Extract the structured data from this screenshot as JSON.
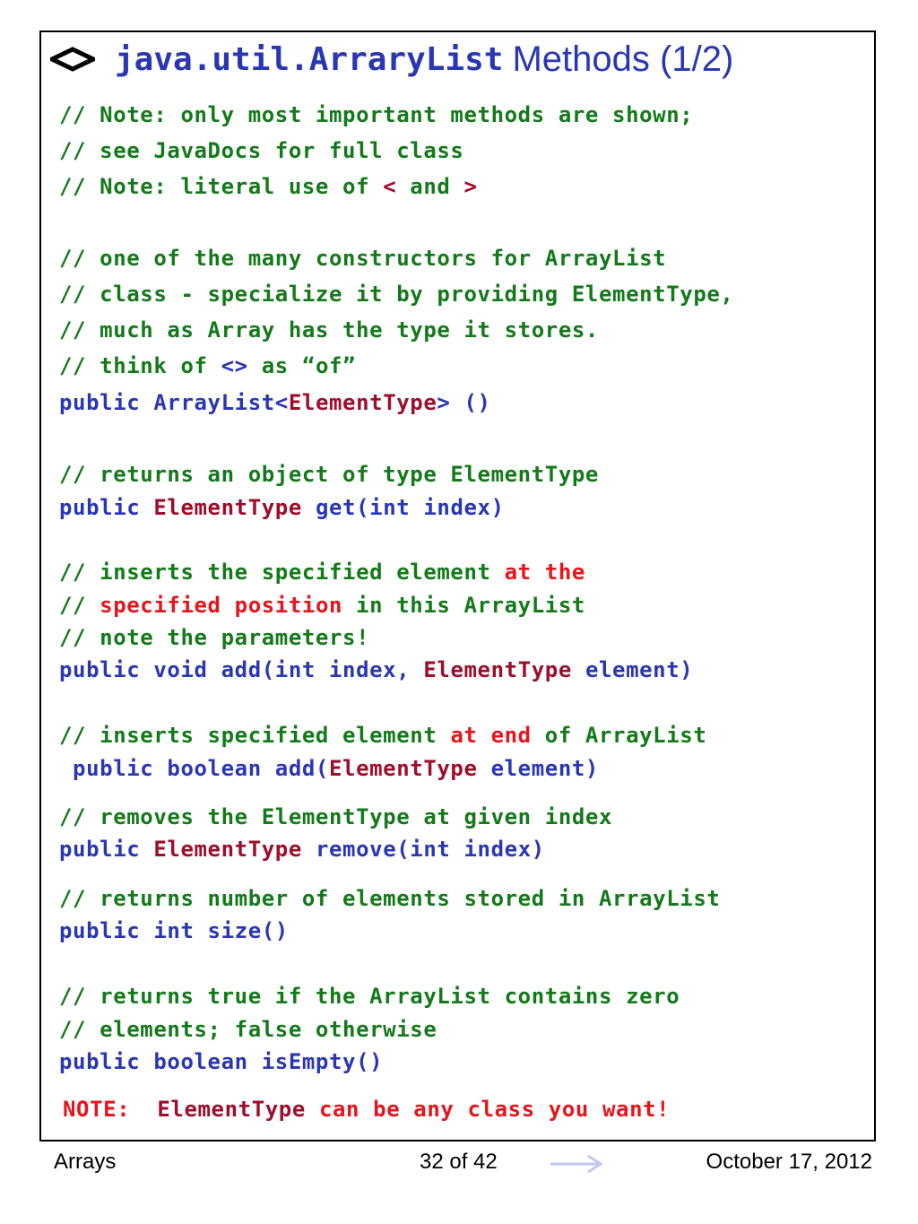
{
  "title": {
    "code": "java.util.ArraryList",
    "rest": "Methods (1/2)"
  },
  "lines": [
    [
      {
        "t": "// Note: only most important methods are shown;",
        "c": "g"
      }
    ],
    [
      {
        "t": "// see JavaDocs for full class",
        "c": "g"
      }
    ],
    [
      {
        "t": "// Note: literal use of ",
        "c": "g"
      },
      {
        "t": "<",
        "c": "m"
      },
      {
        "t": " and ",
        "c": "g"
      },
      {
        "t": ">",
        "c": "m"
      }
    ],
    [
      {
        "t": "// one of the many constructors for ArrayList",
        "c": "g"
      }
    ],
    [
      {
        "t": "// class - specialize it by providing ElementType,",
        "c": "g"
      }
    ],
    [
      {
        "t": "// much as Array has the type it stores.",
        "c": "g"
      }
    ],
    [
      {
        "t": "// think of ",
        "c": "g"
      },
      {
        "t": "<>",
        "c": "b"
      },
      {
        "t": " as “of”",
        "c": "g"
      }
    ],
    [
      {
        "t": "public ArrayList<",
        "c": "b"
      },
      {
        "t": "ElementType",
        "c": "m"
      },
      {
        "t": "> ()",
        "c": "b"
      }
    ],
    [
      {
        "t": "// returns an object of type ElementType",
        "c": "g"
      }
    ],
    [
      {
        "t": "public ",
        "c": "b"
      },
      {
        "t": "ElementType",
        "c": "m"
      },
      {
        "t": " get(int index)",
        "c": "b"
      }
    ],
    [
      {
        "t": "// inserts the specified element ",
        "c": "g"
      },
      {
        "t": "at the",
        "c": "r"
      }
    ],
    [
      {
        "t": "// ",
        "c": "g"
      },
      {
        "t": "specified position",
        "c": "r"
      },
      {
        "t": " in this ArrayList",
        "c": "g"
      }
    ],
    [
      {
        "t": "// note the parameters!",
        "c": "g"
      }
    ],
    [
      {
        "t": "public void add(int index, ",
        "c": "b"
      },
      {
        "t": "ElementType",
        "c": "m"
      },
      {
        "t": " element)",
        "c": "b"
      }
    ],
    [
      {
        "t": "// inserts specified element ",
        "c": "g"
      },
      {
        "t": "at end",
        "c": "r"
      },
      {
        "t": " of ArrayList",
        "c": "g"
      }
    ],
    [
      {
        "t": " public boolean add(",
        "c": "b"
      },
      {
        "t": "ElementType",
        "c": "m"
      },
      {
        "t": " element)",
        "c": "b"
      }
    ],
    [
      {
        "t": "// removes the ElementType at given index",
        "c": "g"
      }
    ],
    [
      {
        "t": "public ",
        "c": "b"
      },
      {
        "t": "ElementType",
        "c": "m"
      },
      {
        "t": " remove(int index)",
        "c": "b"
      }
    ],
    [
      {
        "t": "// returns number of elements stored in ArrayList",
        "c": "g"
      }
    ],
    [
      {
        "t": "public int size()",
        "c": "b"
      }
    ],
    [
      {
        "t": "// returns true if the ArrayList contains zero",
        "c": "g"
      }
    ],
    [
      {
        "t": "// elements; false otherwise",
        "c": "g"
      }
    ],
    [
      {
        "t": "public boolean isEmpty()",
        "c": "b"
      }
    ],
    [
      {
        "t": "NOTE:  ",
        "c": "r"
      },
      {
        "t": "ElementType",
        "c": "m"
      },
      {
        "t": " can be any class you want!",
        "c": "r"
      }
    ]
  ],
  "footer": {
    "left": "Arrays",
    "center": "32 of 42",
    "right": "October 17, 2012"
  },
  "colors": {
    "comment": "#137a1a",
    "code": "#2a37b5",
    "type": "#9e0d2b",
    "highlight": "#e8141c"
  },
  "icons": {
    "bullet": "diamond-bullet-icon",
    "next": "right-arrow-icon"
  }
}
